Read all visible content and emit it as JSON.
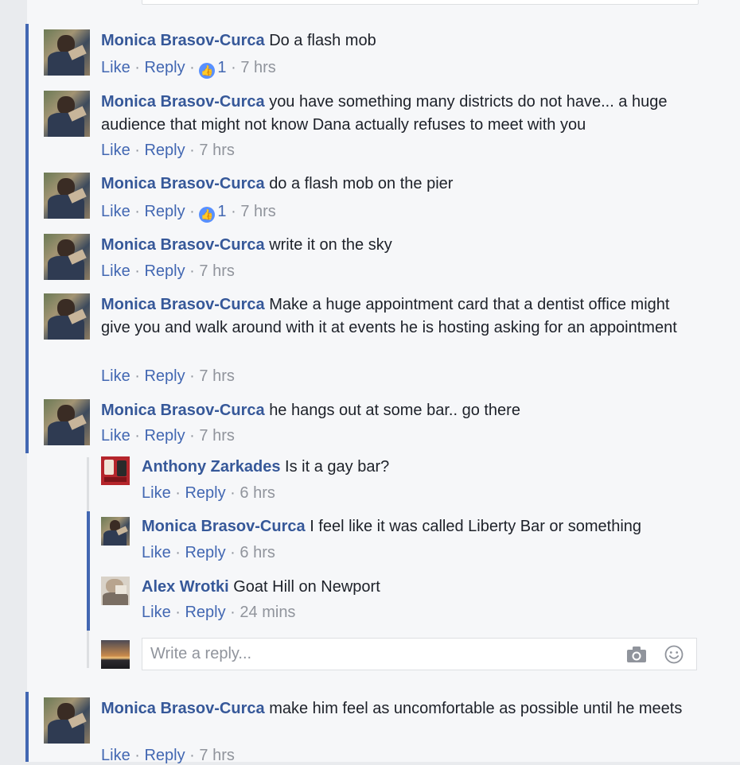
{
  "comments": [
    {
      "author": "Monica Brasov-Curca",
      "text": "Do a flash mob",
      "like": "Like",
      "reply": "Reply",
      "time": "7 hrs",
      "likes": "1"
    },
    {
      "author": "Monica Brasov-Curca",
      "text": "you have something many districts do not have... a huge audience that might not know Dana actually refuses to meet with you",
      "like": "Like",
      "reply": "Reply",
      "time": "7 hrs"
    },
    {
      "author": "Monica Brasov-Curca",
      "text": "do a flash mob on the pier",
      "like": "Like",
      "reply": "Reply",
      "time": "7 hrs",
      "likes": "1"
    },
    {
      "author": "Monica Brasov-Curca",
      "text": "write it on the sky",
      "like": "Like",
      "reply": "Reply",
      "time": "7 hrs"
    },
    {
      "author": "Monica Brasov-Curca",
      "text": "Make a huge appointment card that a dentist office might give you and walk around with it at events he is hosting asking for an appointment",
      "like": "Like",
      "reply": "Reply",
      "time": "7 hrs"
    },
    {
      "author": "Monica Brasov-Curca",
      "text": "he hangs out at some bar.. go there",
      "like": "Like",
      "reply": "Reply",
      "time": "7 hrs"
    }
  ],
  "replies": [
    {
      "author": "Anthony Zarkades",
      "text": "Is it a gay bar?",
      "like": "Like",
      "reply": "Reply",
      "time": "6 hrs"
    },
    {
      "author": "Monica Brasov-Curca",
      "text": "I feel like it was called Liberty Bar or something",
      "like": "Like",
      "reply": "Reply",
      "time": "6 hrs"
    },
    {
      "author": "Alex Wrotki",
      "text": "Goat Hill on Newport",
      "like": "Like",
      "reply": "Reply",
      "time": "24 mins"
    }
  ],
  "reply_box": {
    "placeholder": "Write a reply...",
    "camera_icon": "camera-icon",
    "emoji_icon": "smiley-icon"
  },
  "last_comment": {
    "author": "Monica Brasov-Curca",
    "text": "make him feel as uncomfortable as possible until he meets",
    "like": "Like",
    "reply": "Reply",
    "time": "7 hrs"
  },
  "colors": {
    "author": "#365899",
    "link": "#4267b2",
    "meta": "#90949c",
    "thread_bar": "#4267b2",
    "like_badge": "#5890ff"
  }
}
